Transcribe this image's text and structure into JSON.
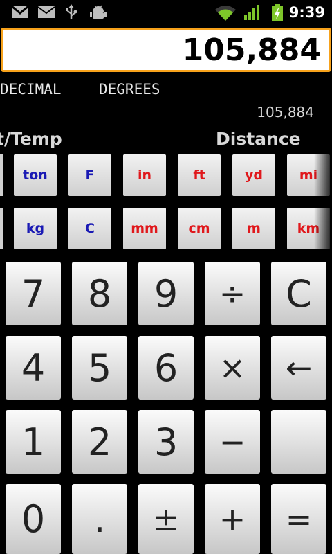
{
  "status_bar": {
    "time": "9:39",
    "icons": [
      "gmail-icon",
      "email-icon",
      "usb-icon",
      "android-debug-icon",
      "wifi-icon",
      "signal-icon",
      "battery-charging-icon"
    ]
  },
  "display": {
    "value": "105,884"
  },
  "modes": {
    "number_mode": "DECIMAL",
    "angle_mode": "DEGREES"
  },
  "secondary_value": "105,884",
  "categories": {
    "left": "t/Temp",
    "right": "Distance"
  },
  "unit_row_1": [
    "ton",
    "F",
    "in",
    "ft",
    "yd",
    "mi"
  ],
  "unit_row_2": [
    "kg",
    "C",
    "mm",
    "cm",
    "m",
    "km"
  ],
  "keypad": {
    "row1": [
      "7",
      "8",
      "9",
      "÷",
      "C"
    ],
    "row2": [
      "4",
      "5",
      "6",
      "×",
      "←"
    ],
    "row3": [
      "1",
      "2",
      "3",
      "−",
      ""
    ],
    "row4": [
      "0",
      ".",
      "±",
      "+",
      "="
    ]
  },
  "colors": {
    "display_border": "#f7a21b",
    "unit_blue": "#1a1ab4",
    "unit_red": "#e0181c"
  }
}
